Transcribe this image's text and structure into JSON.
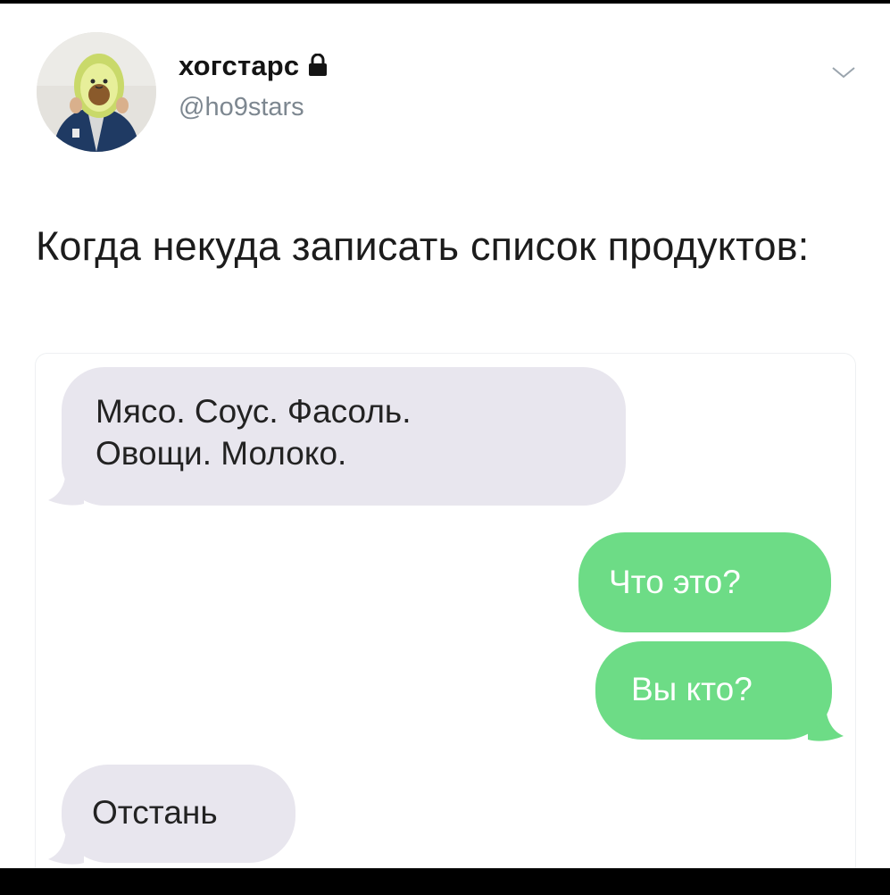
{
  "tweet": {
    "author": {
      "display_name": "хогстарс",
      "handle": "@ho9stars",
      "protected_icon": "lock-icon",
      "avatar": "avatar-avocado-plush"
    },
    "menu_icon": "chevron-down-icon",
    "text": "Когда некуда записать список продуктов:"
  },
  "conversation": {
    "messages": [
      {
        "side": "incoming",
        "lines": [
          "Мясо. Соус. Фасоль.",
          "Овощи. Молоко."
        ]
      },
      {
        "side": "outgoing",
        "lines": [
          "Что это?"
        ]
      },
      {
        "side": "outgoing",
        "lines": [
          "Вы кто?"
        ]
      },
      {
        "side": "incoming",
        "lines": [
          "Отстань"
        ]
      }
    ]
  },
  "colors": {
    "incoming_bubble": "#e8e6ee",
    "outgoing_bubble": "#6ddc86",
    "handle_text": "#7d8790"
  }
}
